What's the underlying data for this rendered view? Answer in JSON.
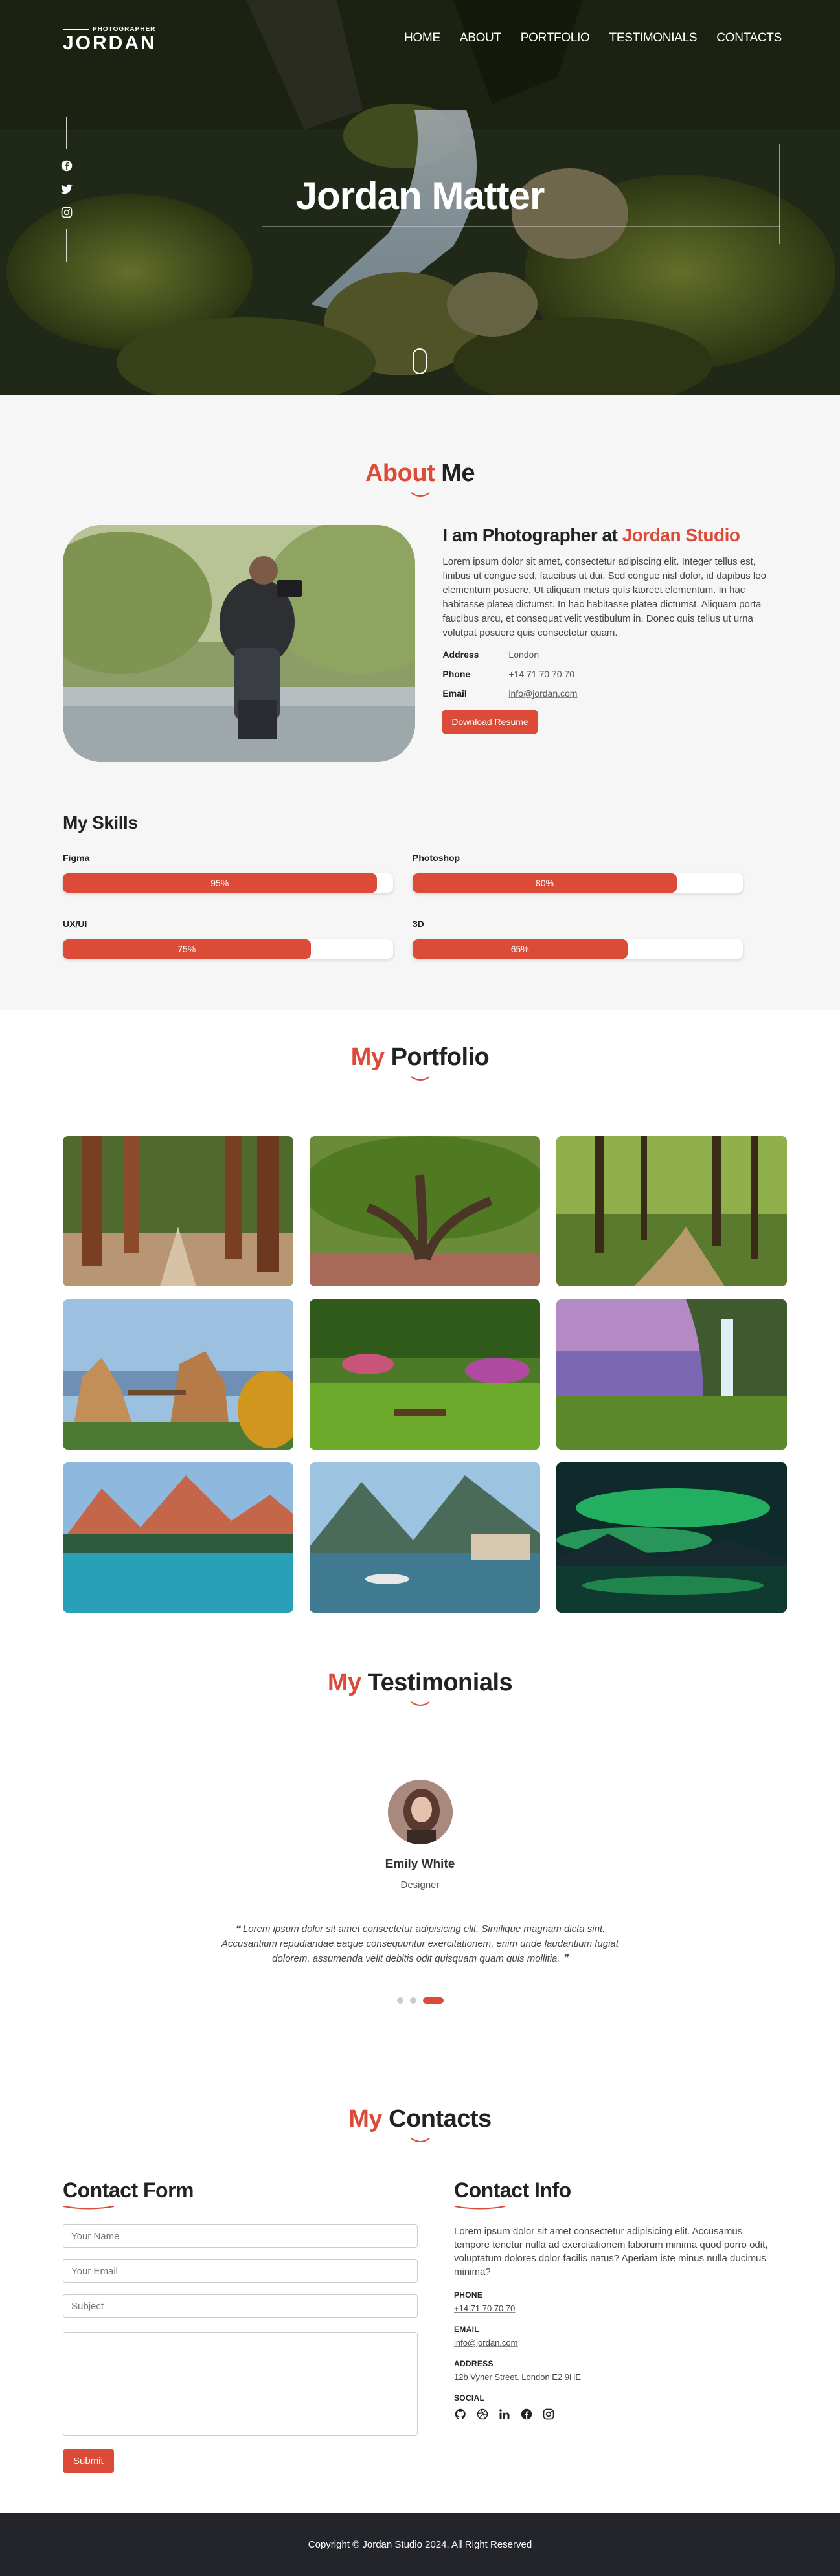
{
  "header": {
    "logo_small": "PHOTOGRAPHER",
    "logo_big": "JORDAN",
    "nav": [
      "HOME",
      "ABOUT",
      "PORTFOLIO",
      "TESTIMONIALS",
      "CONTACTS"
    ]
  },
  "hero": {
    "title": "Jordan Matter",
    "social_icons": [
      "facebook-icon",
      "twitter-icon",
      "instagram-icon"
    ]
  },
  "about": {
    "title_accent": "About",
    "title_rest": " Me",
    "heading_prefix": "I am Photographer at ",
    "heading_accent": "Jordan Studio",
    "bio": "Lorem ipsum dolor sit amet, consectetur adipiscing elit. Integer tellus est, finibus ut congue sed, faucibus ut dui. Sed congue nisl dolor, id dapibus leo elementum posuere. Ut aliquam metus quis laoreet elementum. In hac habitasse platea dictumst. In hac habitasse platea dictumst. Aliquam porta faucibus arcu, et consequat velit vestibulum in. Donec quis tellus ut urna volutpat posuere quis consectetur quam.",
    "address_label": "Address",
    "address_value": "London",
    "phone_label": "Phone",
    "phone_value": "+14 71 70 70 70",
    "email_label": "Email",
    "email_value": "info@jordan.com",
    "download_label": "Download Resume"
  },
  "skills": {
    "title": "My Skills",
    "items": [
      {
        "name": "Figma",
        "percent": 95,
        "label": "95%"
      },
      {
        "name": "Photoshop",
        "percent": 80,
        "label": "80%"
      },
      {
        "name": "UX/UI",
        "percent": 75,
        "label": "75%"
      },
      {
        "name": "3D",
        "percent": 65,
        "label": "65%"
      }
    ]
  },
  "portfolio": {
    "title_accent": "My",
    "title_rest": " Portfolio"
  },
  "testimonials": {
    "title_accent": "My",
    "title_rest": " Testimonials",
    "name": "Emily White",
    "role": "Designer",
    "quote": "Lorem ipsum dolor sit amet consectetur adipisicing elit. Similique magnam dicta sint. Accusantium repudiandae eaque consequuntur exercitationem, enim unde laudantium fugiat dolorem, assumenda velit debitis odit quisquam quam quis mollitia."
  },
  "contacts": {
    "title_accent": "My",
    "title_rest": " Contacts",
    "form_title": "Contact Form",
    "name_placeholder": "Your Name",
    "email_placeholder": "Your Email",
    "subject_placeholder": "Subject",
    "submit_label": "Submit",
    "info_title": "Contact Info",
    "info_text": "Lorem ipsum dolor sit amet consectetur adipisicing elit. Accusamus tempore tenetur nulla ad exercitationem laborum minima quod porro odit, voluptatum dolores dolor facilis natus? Aperiam iste minus nulla ducimus minima?",
    "phone_label": "PHONE",
    "phone_value": "+14 71 70 70 70",
    "email_label": "EMAIL",
    "email_value": "info@jordan.com",
    "address_label": "ADDRESS",
    "address_value": "12b Vyner Street. London E2 9HE",
    "social_label": "SOCIAL"
  },
  "footer": {
    "text": "Copyright © Jordan Studio 2024. All Right Reserved"
  },
  "colors": {
    "accent": "#dc4a38",
    "footer_bg": "#23252b",
    "about_bg": "#f6f6f6"
  }
}
